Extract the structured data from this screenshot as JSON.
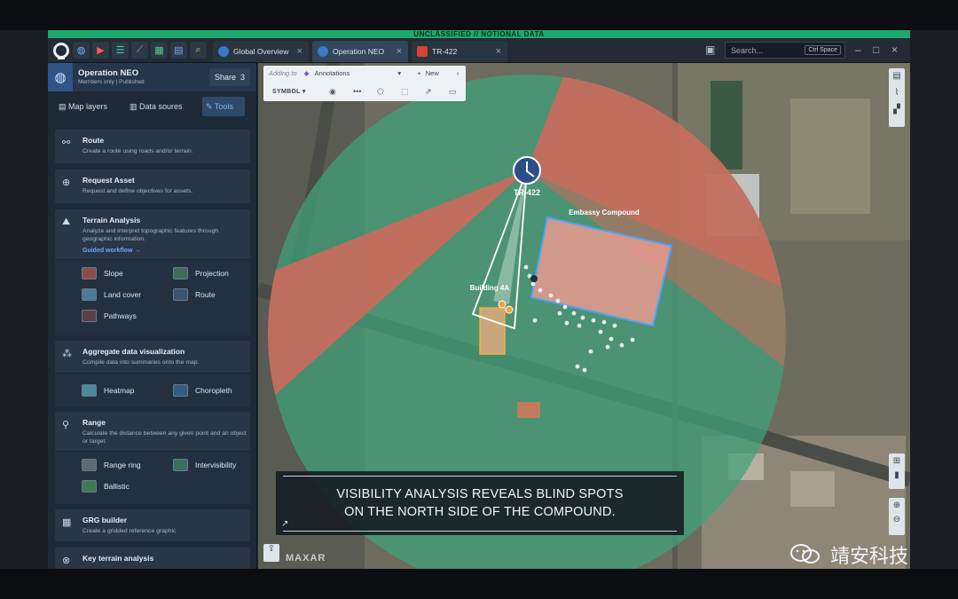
{
  "classification": "UNCLASSIFIED // NOTIONAL DATA",
  "tabs": [
    {
      "label": "Global Overview",
      "active": false
    },
    {
      "label": "Operation NEO",
      "active": true
    },
    {
      "label": "TR-422",
      "active": false
    }
  ],
  "search": {
    "placeholder": "Search...",
    "shortcut": "Ctrl Space"
  },
  "project": {
    "title": "Operation NEO",
    "subtitle": "Members only | Published",
    "share_label": "Share",
    "share_count": "3"
  },
  "sidebar_tabs": {
    "map_layers": "Map layers",
    "data_sources": "Data soures",
    "tools": "Tools"
  },
  "tools": {
    "route": {
      "title": "Route",
      "desc": "Create a route using roads and/or terrain."
    },
    "request_asset": {
      "title": "Request Asset",
      "desc": "Request and define objectives for assets."
    },
    "terrain": {
      "title": "Terrain Analysis",
      "desc": "Analyze and interpret topographic features through geographic information.",
      "link": "Guided workflow →",
      "items": [
        "Slope",
        "Projection",
        "Land cover",
        "Route",
        "Pathways"
      ]
    },
    "aggregate": {
      "title": "Aggregate data visualization",
      "desc": "Compile data into summaries onto the map.",
      "items": [
        "Heatmap",
        "Choropleth"
      ]
    },
    "range": {
      "title": "Range",
      "desc": "Calculate the distance between any given point and an object or target.",
      "items": [
        "Range ring",
        "Intervisibility",
        "Ballistic"
      ]
    },
    "grg": {
      "title": "GRG builder",
      "desc": "Create a gridded reference graphic"
    },
    "key_terrain": {
      "title": "Key terrain analysis"
    }
  },
  "annotation_toolbar": {
    "adding_to": "Adding to",
    "layer": "Annotations",
    "new_label": "New",
    "symbol_label": "SYMBOL"
  },
  "map_labels": {
    "unit": "TR-422",
    "compound": "Embassy Compound",
    "building": "Building 4A",
    "imagery_credit": "MAXAR"
  },
  "caption": {
    "line1": "VISIBILITY ANALYSIS REVEALS BLIND SPOTS",
    "line2": "ON THE NORTH SIDE OF THE COMPOUND."
  },
  "watermark": "靖安科技",
  "colors": {
    "class_bar": "#1fa86b",
    "visible_zone": "#3fa27a",
    "blind_zone": "#d9665a",
    "accent": "#6fa8ff"
  }
}
